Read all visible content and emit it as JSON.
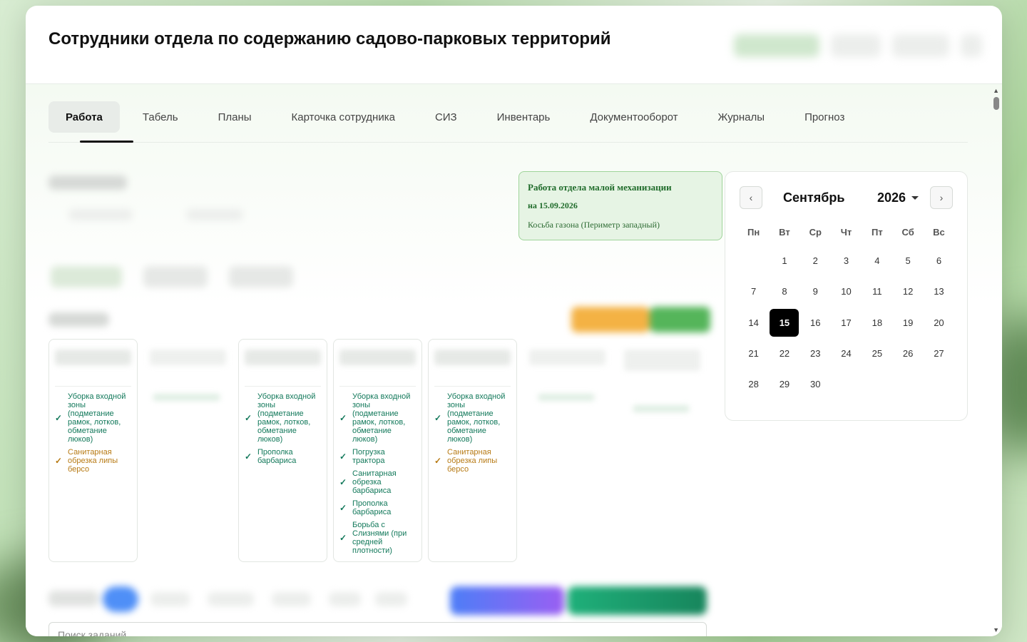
{
  "header": {
    "title": "Сотрудники отдела по содержанию садово-парковых территорий"
  },
  "tabs": [
    {
      "label": "Работа",
      "active": true
    },
    {
      "label": "Табель"
    },
    {
      "label": "Планы"
    },
    {
      "label": "Карточка сотрудника"
    },
    {
      "label": "СИЗ"
    },
    {
      "label": "Инвентарь"
    },
    {
      "label": "Документооборот"
    },
    {
      "label": "Журналы"
    },
    {
      "label": "Прогноз"
    }
  ],
  "notice": {
    "line1": "Работа отдела малой механизации",
    "line2": "на 15.09.2026",
    "line3": "Косьба газона (Периметр западный)"
  },
  "calendar": {
    "prev": "‹",
    "next": "›",
    "month": "Сентябрь",
    "year": "2026",
    "weekdays": [
      "Пн",
      "Вт",
      "Ср",
      "Чт",
      "Пт",
      "Сб",
      "Вс"
    ],
    "weeks": [
      [
        "",
        "1",
        "2",
        "3",
        "4",
        "5",
        "6"
      ],
      [
        "7",
        "8",
        "9",
        "10",
        "11",
        "12",
        "13"
      ],
      [
        "14",
        "15",
        "16",
        "17",
        "18",
        "19",
        "20"
      ],
      [
        "21",
        "22",
        "23",
        "24",
        "25",
        "26",
        "27"
      ],
      [
        "28",
        "29",
        "30",
        "",
        "",
        "",
        ""
      ]
    ],
    "selected": "15"
  },
  "cards": [
    {
      "tasks": [
        {
          "text": "Уборка входной зоны (подметание рамок, лотков, обметание люков)",
          "status": "green"
        },
        {
          "text": "Санитарная обрезка липы берсо",
          "status": "orange"
        }
      ]
    },
    {
      "tasks": [
        {
          "text": "Уборка входной зоны (подметание рамок, лотков, обметание люков)",
          "status": "green"
        },
        {
          "text": "Прополка барбариса",
          "status": "green"
        }
      ]
    },
    {
      "tasks": [
        {
          "text": "Уборка входной зоны (подметание рамок, лотков, обметание люков)",
          "status": "green"
        },
        {
          "text": "Погрузка трактора",
          "status": "green"
        },
        {
          "text": "Санитарная обрезка барбариса",
          "status": "green"
        },
        {
          "text": "Прополка барбариса",
          "status": "green"
        },
        {
          "text": "Борьба с Слизнями (при средней плотности)",
          "status": "green"
        }
      ]
    },
    {
      "tasks": [
        {
          "text": "Уборка входной зоны (подметание рамок, лотков, обметание люков)",
          "status": "green"
        },
        {
          "text": "Санитарная обрезка липы берсо",
          "status": "orange"
        }
      ]
    }
  ],
  "search": {
    "placeholder": "Поиск заданий..."
  },
  "colors": {
    "task_done": "#13795b",
    "task_pending": "#b77a14",
    "notice_bg": "#e6f4e4",
    "selected_day": "#000000"
  },
  "icons": {
    "check": "check-icon",
    "caret": "chevron-down-icon"
  }
}
